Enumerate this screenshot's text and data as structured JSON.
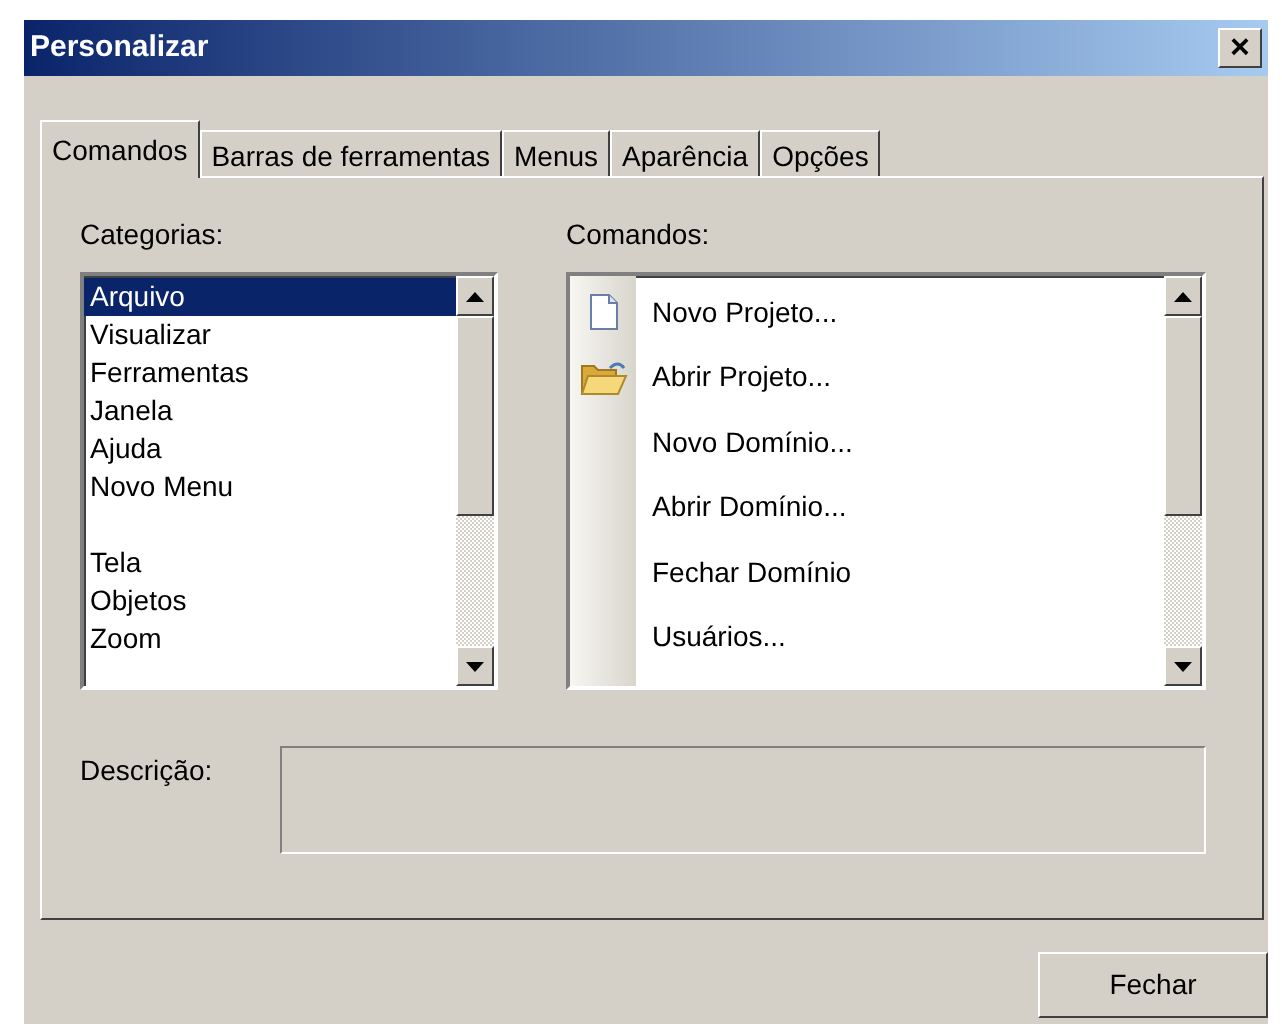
{
  "window": {
    "title": "Personalizar",
    "close": "×"
  },
  "tabs": [
    {
      "label": "Comandos",
      "selected": true
    },
    {
      "label": "Barras de ferramentas",
      "selected": false
    },
    {
      "label": "Menus",
      "selected": false
    },
    {
      "label": "Aparência",
      "selected": false
    },
    {
      "label": "Opções",
      "selected": false
    }
  ],
  "categories": {
    "label": "Categorias:",
    "groups": [
      {
        "items": [
          {
            "text": "Arquivo",
            "selected": true
          },
          {
            "text": "Visualizar",
            "selected": false
          },
          {
            "text": "Ferramentas",
            "selected": false
          },
          {
            "text": "Janela",
            "selected": false
          },
          {
            "text": "Ajuda",
            "selected": false
          },
          {
            "text": "Novo Menu",
            "selected": false
          }
        ]
      },
      {
        "items": [
          {
            "text": "Tela",
            "selected": false
          },
          {
            "text": "Objetos",
            "selected": false
          },
          {
            "text": "Zoom",
            "selected": false
          }
        ]
      }
    ]
  },
  "commands": {
    "label": "Comandos:",
    "items": [
      {
        "text": "Novo Projeto...",
        "kind": "document"
      },
      {
        "text": "Abrir Projeto...",
        "kind": "folder"
      },
      {
        "text": "Novo Domínio...",
        "kind": "plain"
      },
      {
        "text": "Abrir Domínio...",
        "kind": "plain"
      },
      {
        "text": "Fechar Domínio",
        "kind": "plain"
      },
      {
        "text": "Usuários...",
        "kind": "plain"
      }
    ]
  },
  "description": {
    "label": "Descrição:"
  },
  "buttons": [
    {
      "label": "Fechar"
    }
  ]
}
